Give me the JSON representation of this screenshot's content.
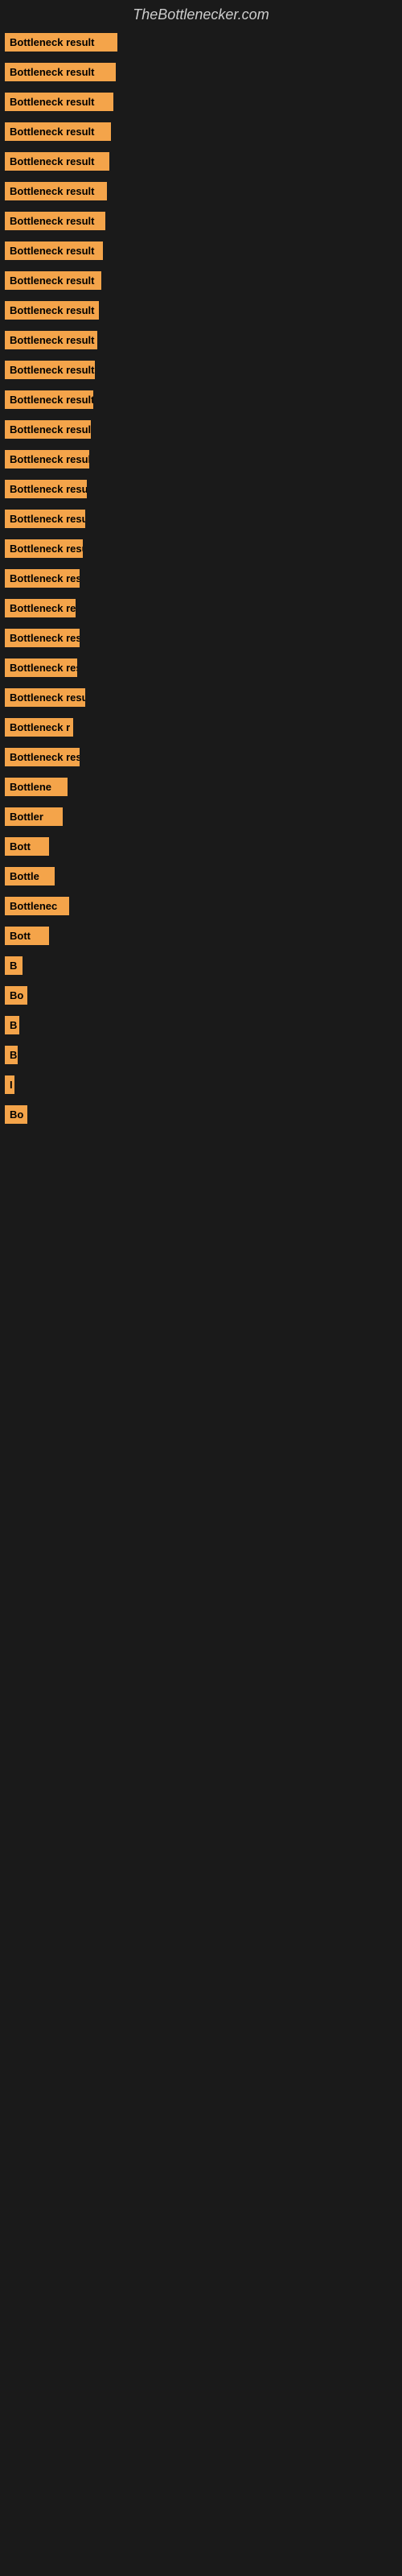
{
  "site": {
    "title": "TheBottlenecker.com"
  },
  "bars": [
    {
      "label": "Bottleneck result",
      "width": 140
    },
    {
      "label": "Bottleneck result",
      "width": 138
    },
    {
      "label": "Bottleneck result",
      "width": 135
    },
    {
      "label": "Bottleneck result",
      "width": 132
    },
    {
      "label": "Bottleneck result",
      "width": 130
    },
    {
      "label": "Bottleneck result",
      "width": 127
    },
    {
      "label": "Bottleneck result",
      "width": 125
    },
    {
      "label": "Bottleneck result",
      "width": 122
    },
    {
      "label": "Bottleneck result",
      "width": 120
    },
    {
      "label": "Bottleneck result",
      "width": 117
    },
    {
      "label": "Bottleneck result",
      "width": 115
    },
    {
      "label": "Bottleneck result",
      "width": 112
    },
    {
      "label": "Bottleneck result",
      "width": 110
    },
    {
      "label": "Bottleneck result",
      "width": 107
    },
    {
      "label": "Bottleneck result",
      "width": 105
    },
    {
      "label": "Bottleneck result",
      "width": 102
    },
    {
      "label": "Bottleneck result",
      "width": 100
    },
    {
      "label": "Bottleneck result",
      "width": 97
    },
    {
      "label": "Bottleneck resu",
      "width": 93
    },
    {
      "label": "Bottleneck re",
      "width": 88
    },
    {
      "label": "Bottleneck resu",
      "width": 93
    },
    {
      "label": "Bottleneck res",
      "width": 90
    },
    {
      "label": "Bottleneck result",
      "width": 100
    },
    {
      "label": "Bottleneck r",
      "width": 85
    },
    {
      "label": "Bottleneck resu",
      "width": 93
    },
    {
      "label": "Bottlene",
      "width": 78
    },
    {
      "label": "Bottler",
      "width": 72
    },
    {
      "label": "Bott",
      "width": 55
    },
    {
      "label": "Bottle",
      "width": 62
    },
    {
      "label": "Bottlenec",
      "width": 80
    },
    {
      "label": "Bott",
      "width": 55
    },
    {
      "label": "B",
      "width": 22
    },
    {
      "label": "Bo",
      "width": 28
    },
    {
      "label": "B",
      "width": 18
    },
    {
      "label": "B",
      "width": 16
    },
    {
      "label": "I",
      "width": 10
    },
    {
      "label": "Bo",
      "width": 28
    }
  ]
}
